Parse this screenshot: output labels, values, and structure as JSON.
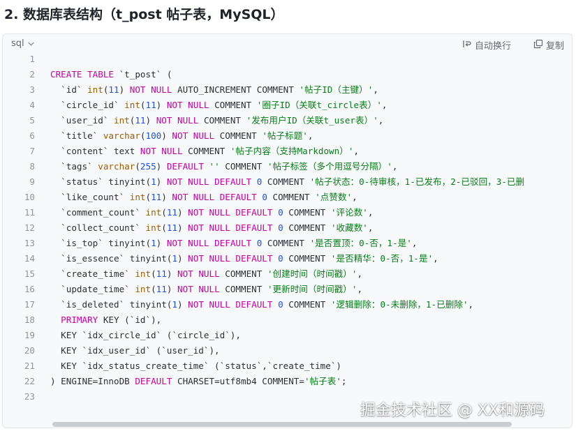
{
  "heading": "2. 数据库表结构（t_post 帖子表，MySQL）",
  "code_block": {
    "language": "sql",
    "wrap_label": "自动换行",
    "copy_label": "复制",
    "line_numbers": [
      "1",
      "2",
      "3",
      "4",
      "5",
      "6",
      "7",
      "8",
      "9",
      "10",
      "11",
      "12",
      "13",
      "14",
      "15",
      "16",
      "17",
      "18",
      "19",
      "20",
      "21",
      "22",
      "23"
    ],
    "lines": [
      [],
      [
        [
          "CREATE TABLE",
          "kw"
        ],
        [
          " `t_post` (",
          ""
        ]
      ],
      [
        [
          "  `id` ",
          ""
        ],
        [
          "int",
          "type"
        ],
        [
          "(",
          ""
        ],
        [
          "11",
          "num"
        ],
        [
          ") ",
          ""
        ],
        [
          "NOT NULL",
          "kw"
        ],
        [
          " AUTO_INCREMENT COMMENT ",
          ""
        ],
        [
          "'帖子ID（主键）'",
          "str"
        ],
        [
          ",",
          ""
        ]
      ],
      [
        [
          "  `circle_id` ",
          ""
        ],
        [
          "int",
          "type"
        ],
        [
          "(",
          ""
        ],
        [
          "11",
          "num"
        ],
        [
          ") ",
          ""
        ],
        [
          "NOT NULL",
          "kw"
        ],
        [
          " COMMENT ",
          ""
        ],
        [
          "'圈子ID（关联t_circle表）'",
          "str"
        ],
        [
          ",",
          ""
        ]
      ],
      [
        [
          "  `user_id` ",
          ""
        ],
        [
          "int",
          "type"
        ],
        [
          "(",
          ""
        ],
        [
          "11",
          "num"
        ],
        [
          ") ",
          ""
        ],
        [
          "NOT NULL",
          "kw"
        ],
        [
          " COMMENT ",
          ""
        ],
        [
          "'发布用户ID（关联t_user表）'",
          "str"
        ],
        [
          ",",
          ""
        ]
      ],
      [
        [
          "  `title` ",
          ""
        ],
        [
          "varchar",
          "type"
        ],
        [
          "(",
          ""
        ],
        [
          "100",
          "num"
        ],
        [
          ") ",
          ""
        ],
        [
          "NOT NULL",
          "kw"
        ],
        [
          " COMMENT ",
          ""
        ],
        [
          "'帖子标题'",
          "str"
        ],
        [
          ",",
          ""
        ]
      ],
      [
        [
          "  `content` text ",
          ""
        ],
        [
          "NOT NULL",
          "kw"
        ],
        [
          " COMMENT ",
          ""
        ],
        [
          "'帖子内容（支持Markdown）'",
          "str"
        ],
        [
          ",",
          ""
        ]
      ],
      [
        [
          "  `tags` ",
          ""
        ],
        [
          "varchar",
          "type"
        ],
        [
          "(",
          ""
        ],
        [
          "255",
          "num"
        ],
        [
          ") ",
          ""
        ],
        [
          "DEFAULT",
          "kw"
        ],
        [
          " ",
          ""
        ],
        [
          "''",
          "str"
        ],
        [
          " COMMENT ",
          ""
        ],
        [
          "'帖子标签（多个用逗号分隔）'",
          "str"
        ],
        [
          ",",
          ""
        ]
      ],
      [
        [
          "  `status` tinyint(",
          ""
        ],
        [
          "1",
          "num"
        ],
        [
          ") ",
          ""
        ],
        [
          "NOT NULL DEFAULT",
          "kw"
        ],
        [
          " ",
          ""
        ],
        [
          "0",
          "num"
        ],
        [
          " COMMENT ",
          ""
        ],
        [
          "'帖子状态：0-待审核，1-已发布，2-已驳回，3-已删",
          "str"
        ]
      ],
      [
        [
          "  `like_count` ",
          ""
        ],
        [
          "int",
          "type"
        ],
        [
          "(",
          ""
        ],
        [
          "11",
          "num"
        ],
        [
          ") ",
          ""
        ],
        [
          "NOT NULL DEFAULT",
          "kw"
        ],
        [
          " ",
          ""
        ],
        [
          "0",
          "num"
        ],
        [
          " COMMENT ",
          ""
        ],
        [
          "'点赞数'",
          "str"
        ],
        [
          ",",
          ""
        ]
      ],
      [
        [
          "  `comment_count` ",
          ""
        ],
        [
          "int",
          "type"
        ],
        [
          "(",
          ""
        ],
        [
          "11",
          "num"
        ],
        [
          ") ",
          ""
        ],
        [
          "NOT NULL DEFAULT",
          "kw"
        ],
        [
          " ",
          ""
        ],
        [
          "0",
          "num"
        ],
        [
          " COMMENT ",
          ""
        ],
        [
          "'评论数'",
          "str"
        ],
        [
          ",",
          ""
        ]
      ],
      [
        [
          "  `collect_count` ",
          ""
        ],
        [
          "int",
          "type"
        ],
        [
          "(",
          ""
        ],
        [
          "11",
          "num"
        ],
        [
          ") ",
          ""
        ],
        [
          "NOT NULL DEFAULT",
          "kw"
        ],
        [
          " ",
          ""
        ],
        [
          "0",
          "num"
        ],
        [
          " COMMENT ",
          ""
        ],
        [
          "'收藏数'",
          "str"
        ],
        [
          ",",
          ""
        ]
      ],
      [
        [
          "  `is_top` tinyint(",
          ""
        ],
        [
          "1",
          "num"
        ],
        [
          ") ",
          ""
        ],
        [
          "NOT NULL DEFAULT",
          "kw"
        ],
        [
          " ",
          ""
        ],
        [
          "0",
          "num"
        ],
        [
          " COMMENT ",
          ""
        ],
        [
          "'是否置顶：0-否，1-是'",
          "str"
        ],
        [
          ",",
          ""
        ]
      ],
      [
        [
          "  `is_essence` tinyint(",
          ""
        ],
        [
          "1",
          "num"
        ],
        [
          ") ",
          ""
        ],
        [
          "NOT NULL DEFAULT",
          "kw"
        ],
        [
          " ",
          ""
        ],
        [
          "0",
          "num"
        ],
        [
          " COMMENT ",
          ""
        ],
        [
          "'是否精华：0-否，1-是'",
          "str"
        ],
        [
          ",",
          ""
        ]
      ],
      [
        [
          "  `create_time` ",
          ""
        ],
        [
          "int",
          "type"
        ],
        [
          "(",
          ""
        ],
        [
          "11",
          "num"
        ],
        [
          ") ",
          ""
        ],
        [
          "NOT NULL",
          "kw"
        ],
        [
          " COMMENT ",
          ""
        ],
        [
          "'创建时间（时间戳）'",
          "str"
        ],
        [
          ",",
          ""
        ]
      ],
      [
        [
          "  `update_time` ",
          ""
        ],
        [
          "int",
          "type"
        ],
        [
          "(",
          ""
        ],
        [
          "11",
          "num"
        ],
        [
          ") ",
          ""
        ],
        [
          "NOT NULL",
          "kw"
        ],
        [
          " COMMENT ",
          ""
        ],
        [
          "'更新时间（时间戳）'",
          "str"
        ],
        [
          ",",
          ""
        ]
      ],
      [
        [
          "  `is_deleted` tinyint(",
          ""
        ],
        [
          "1",
          "num"
        ],
        [
          ") ",
          ""
        ],
        [
          "NOT NULL DEFAULT",
          "kw"
        ],
        [
          " ",
          ""
        ],
        [
          "0",
          "num"
        ],
        [
          " COMMENT ",
          ""
        ],
        [
          "'逻辑删除：0-未删除，1-已删除'",
          "str"
        ],
        [
          ",",
          ""
        ]
      ],
      [
        [
          "  ",
          ""
        ],
        [
          "PRIMARY",
          "kw"
        ],
        [
          " KEY (`id`),",
          ""
        ]
      ],
      [
        [
          "  KEY `idx_circle_id` (`circle_id`),",
          ""
        ]
      ],
      [
        [
          "  KEY `idx_user_id` (`user_id`),",
          ""
        ]
      ],
      [
        [
          "  KEY `idx_status_create_time` (`status`,`create_time`)",
          ""
        ]
      ],
      [
        [
          ") ENGINE=InnoDB ",
          ""
        ],
        [
          "DEFAULT",
          "kw"
        ],
        [
          " CHARSET=utf8mb4 COMMENT=",
          ""
        ],
        [
          "'帖子表'",
          "str"
        ],
        [
          ";",
          ""
        ]
      ],
      []
    ]
  },
  "watermark": "掘金技术社区 @ XX和源码",
  "colors": {
    "keyword": "#c800a4",
    "number": "#1750eb",
    "string": "#067d17",
    "type": "#9c5d00",
    "background": "#f8f9fa"
  }
}
